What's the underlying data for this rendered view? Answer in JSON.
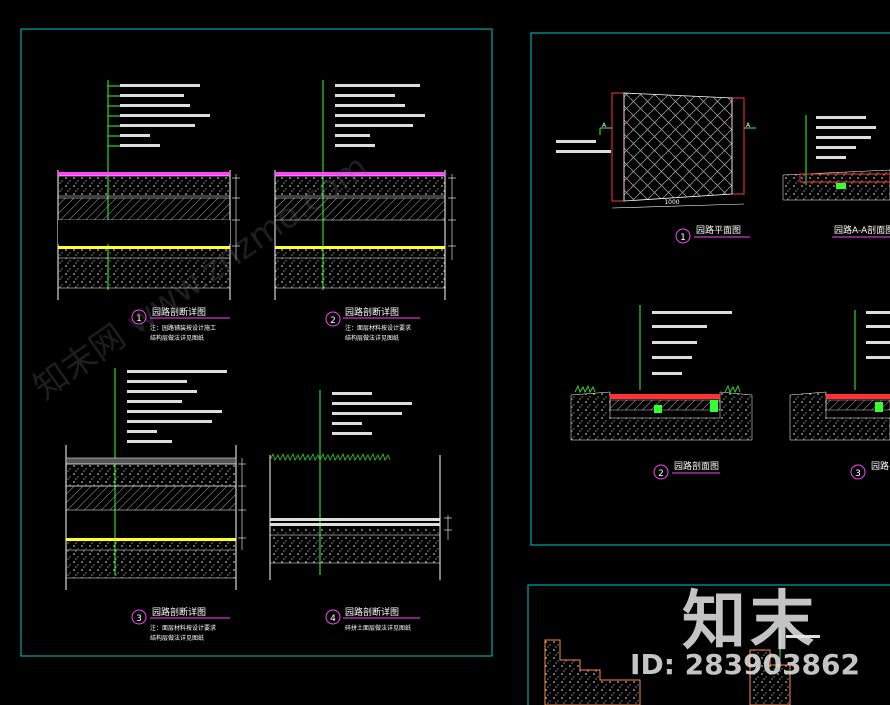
{
  "colors": {
    "frame": "#00c8c8",
    "line": "#ffffff",
    "leader": "#33ff33",
    "pink": "#ff44ff",
    "yellow": "#ffff33",
    "red": "#ff3333",
    "grass": "#33cc33"
  },
  "watermark": {
    "logo": "知末",
    "id": "ID: 283903862",
    "diagonal": "知末网 www.znzmo.com"
  },
  "panel_a": {
    "sections": [
      {
        "num": "1",
        "title": "园路剖断详图",
        "note1": "注：园路铺装按设计施工",
        "note2": "结构层做法详见图纸"
      },
      {
        "num": "2",
        "title": "园路剖断详图",
        "note1": "注：面层材料按设计要求",
        "note2": "结构层做法详见图纸"
      },
      {
        "num": "3",
        "title": "园路剖断详图",
        "note1": "注：面层材料按设计要求",
        "note2": "结构层做法详见图纸"
      },
      {
        "num": "4",
        "title": "园路剖断详图",
        "note1": "碎拼土面层做法详见图纸",
        "note2": ""
      }
    ]
  },
  "panel_b": {
    "items": [
      {
        "num": "1",
        "title": "园路平面图"
      },
      {
        "num": "",
        "title": "园路A-A剖面图"
      },
      {
        "num": "2",
        "title": "园路剖面图"
      },
      {
        "num": "3",
        "title": "园路"
      }
    ],
    "dim": "1000",
    "markA": "A"
  }
}
